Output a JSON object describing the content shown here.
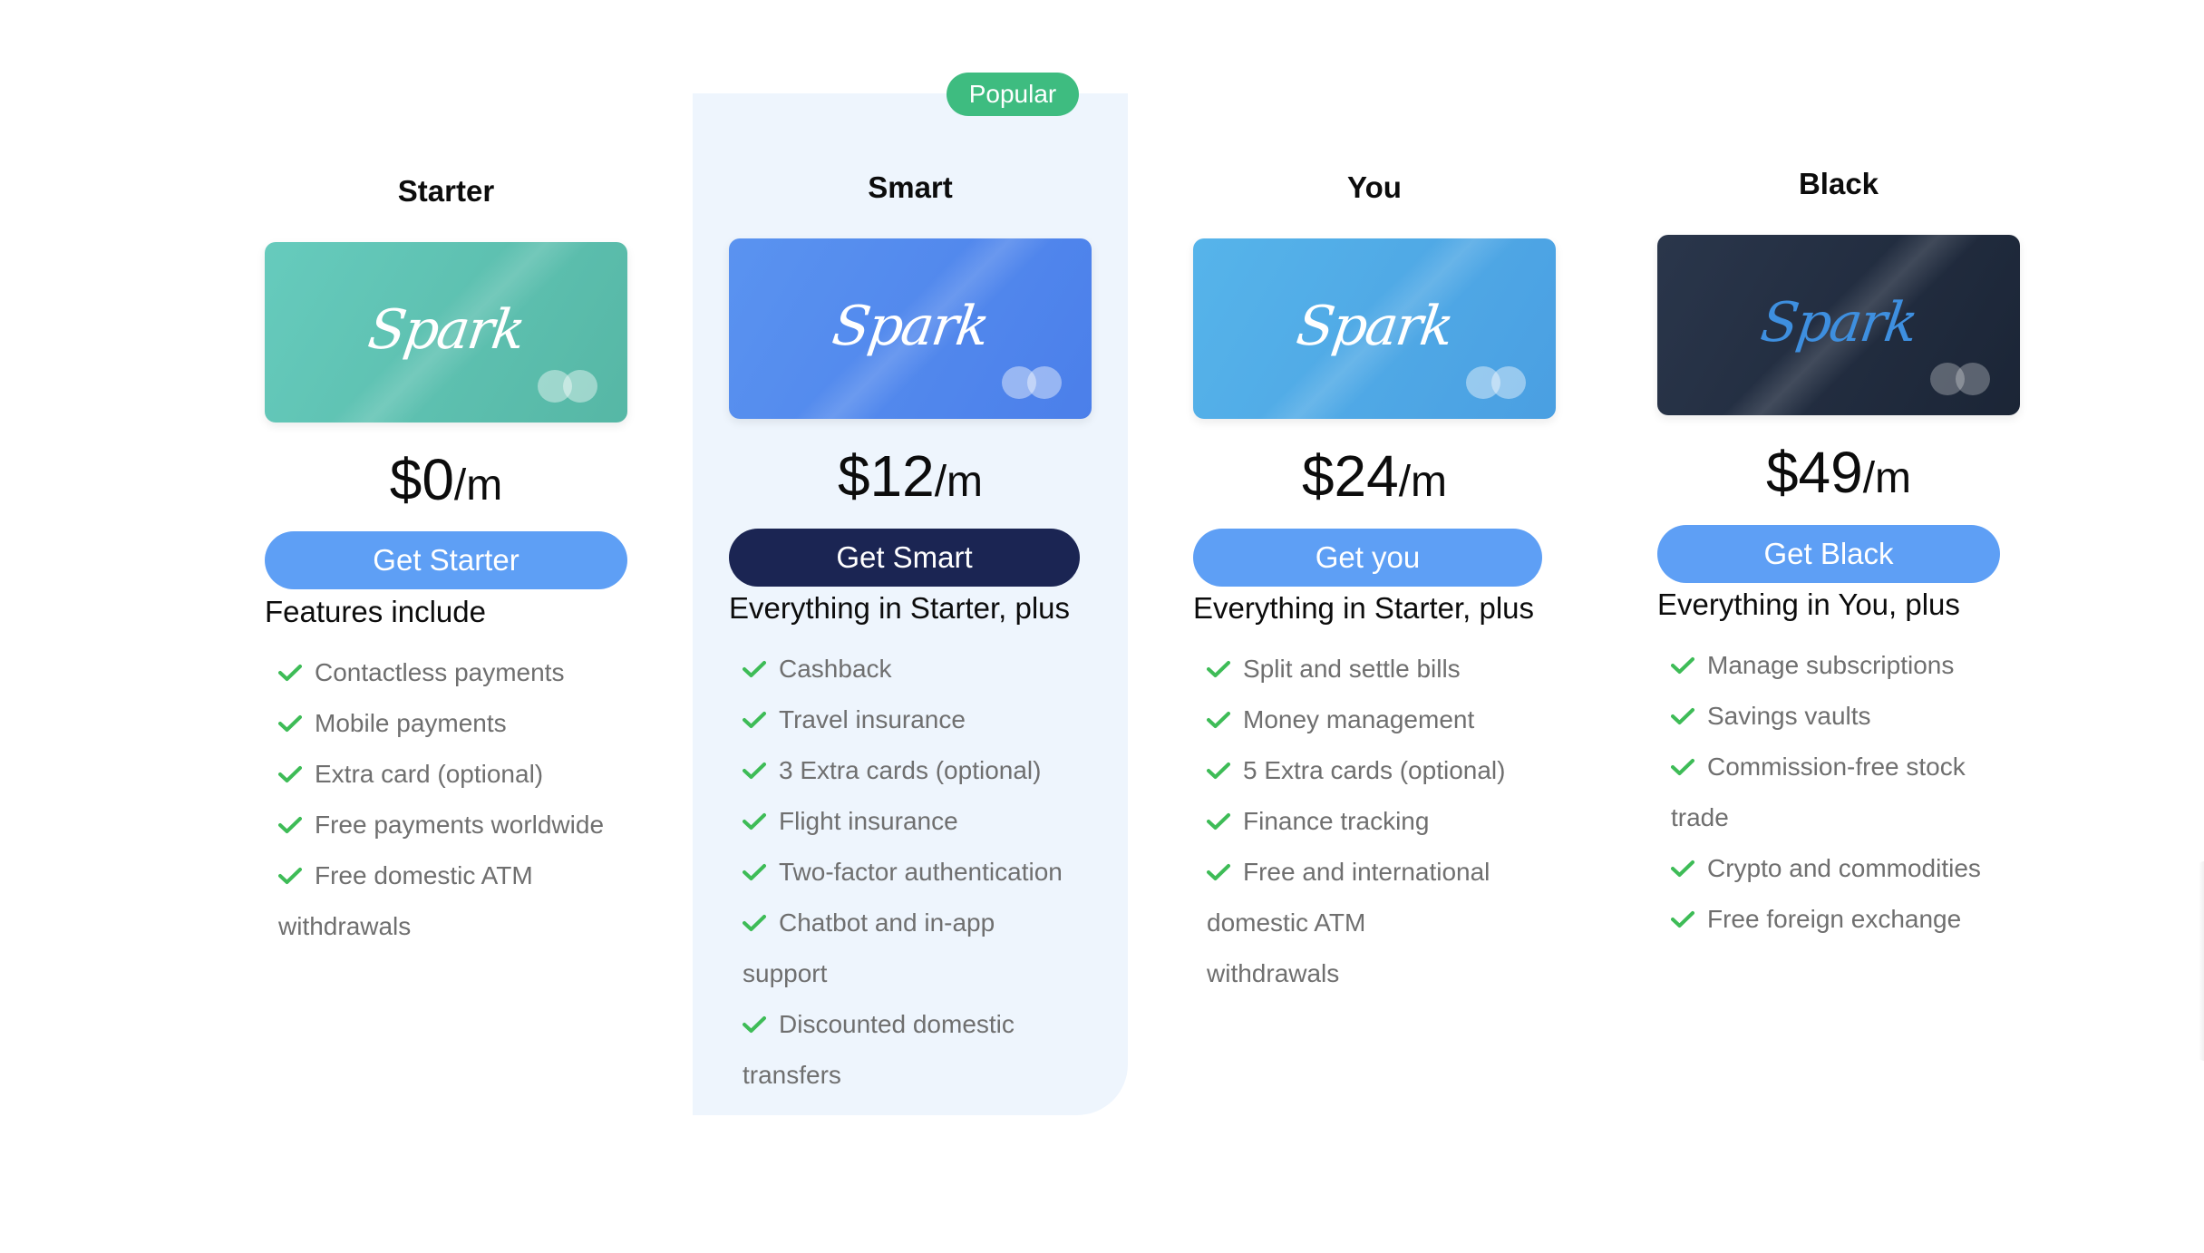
{
  "brand": "Spark",
  "badge": "Popular",
  "plans": [
    {
      "title": "Starter",
      "price": "$0",
      "per": "/m",
      "cta": "Get Starter",
      "intro": "Features include",
      "card_color": "#5bbfae",
      "features": [
        "Contactless payments",
        "Mobile payments",
        "Extra card (optional)",
        "Free payments worldwide",
        "Free domestic ATM",
        "withdrawals"
      ]
    },
    {
      "title": "Smart",
      "price": "$12",
      "per": "/m",
      "cta": "Get Smart",
      "intro": "Everything in Starter, plus",
      "card_color": "#4d84ec",
      "features": [
        "Cashback",
        "Travel insurance",
        "3 Extra cards (optional)",
        "Flight insurance",
        "Two-factor authentication",
        "Chatbot and in-app",
        "support",
        "Discounted domestic",
        "transfers"
      ]
    },
    {
      "title": "You",
      "price": "$24",
      "per": "/m",
      "cta": "Get you",
      "intro": "Everything in Starter, plus",
      "card_color": "#4ea8e6",
      "features": [
        "Split and settle bills",
        "Money management",
        "5 Extra cards (optional)",
        "Finance tracking",
        "Free and international",
        "domestic ATM",
        "withdrawals"
      ]
    },
    {
      "title": "Black",
      "price": "$49",
      "per": "/m",
      "cta": "Get Black",
      "intro": "Everything in You, plus",
      "card_color": "#1e2a3d",
      "features": [
        "Manage subscriptions",
        "Savings vaults",
        "Commission-free stock",
        "trade",
        "Crypto and commodities",
        "Free foreign exchange"
      ]
    }
  ],
  "colors": {
    "check": "#3ebc57",
    "popular_panel": "#eef5fd",
    "badge": "#3ebc80",
    "cta_light": "#5e9ff5",
    "cta_dark": "#1b2553"
  }
}
